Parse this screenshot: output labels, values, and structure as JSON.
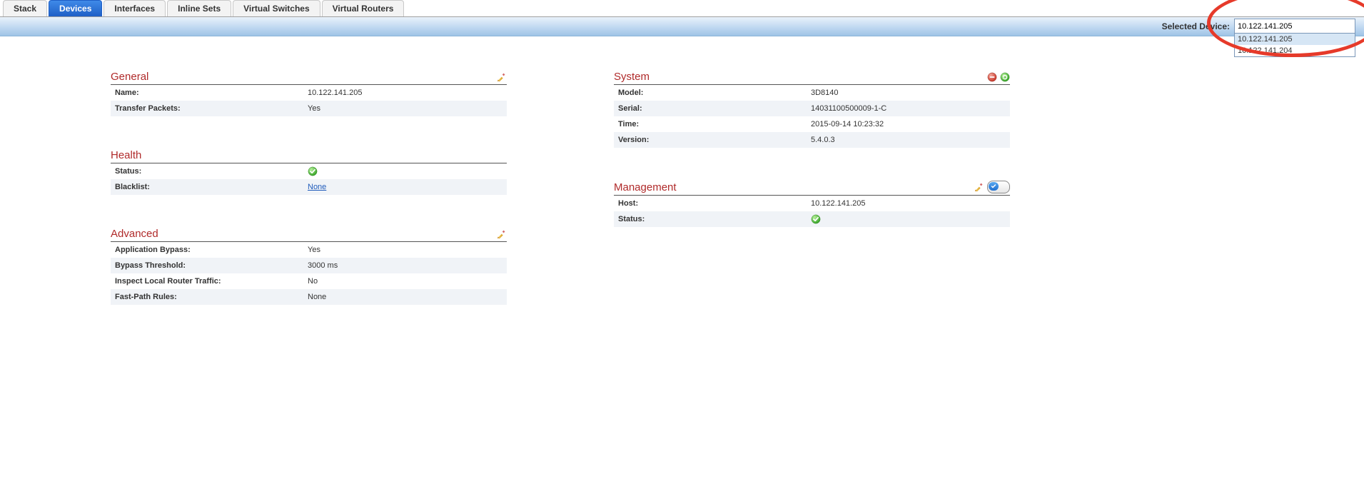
{
  "tabs": [
    {
      "label": "Stack",
      "active": false
    },
    {
      "label": "Devices",
      "active": true
    },
    {
      "label": "Interfaces",
      "active": false
    },
    {
      "label": "Inline Sets",
      "active": false
    },
    {
      "label": "Virtual Switches",
      "active": false
    },
    {
      "label": "Virtual Routers",
      "active": false
    }
  ],
  "selector": {
    "label": "Selected Device:",
    "value": "10.122.141.205",
    "options": [
      "10.122.141.205",
      "10.122.141.204"
    ]
  },
  "panels": {
    "general": {
      "title": "General",
      "rows": [
        {
          "label": "Name:",
          "value": "10.122.141.205"
        },
        {
          "label": "Transfer Packets:",
          "value": "Yes"
        }
      ]
    },
    "health": {
      "title": "Health",
      "status_label": "Status:",
      "blacklist_label": "Blacklist:",
      "blacklist_value": "None"
    },
    "advanced": {
      "title": "Advanced",
      "rows": [
        {
          "label": "Application Bypass:",
          "value": "Yes"
        },
        {
          "label": "Bypass Threshold:",
          "value": "3000 ms"
        },
        {
          "label": "Inspect Local Router Traffic:",
          "value": "No"
        },
        {
          "label": "Fast-Path Rules:",
          "value": "None"
        }
      ]
    },
    "system": {
      "title": "System",
      "rows": [
        {
          "label": "Model:",
          "value": "3D8140"
        },
        {
          "label": "Serial:",
          "value": "14031100500009-1-C"
        },
        {
          "label": "Time:",
          "value": "2015-09-14 10:23:32"
        },
        {
          "label": "Version:",
          "value": "5.4.0.3"
        }
      ]
    },
    "management": {
      "title": "Management",
      "host_label": "Host:",
      "host_value": "10.122.141.205",
      "status_label": "Status:"
    }
  }
}
